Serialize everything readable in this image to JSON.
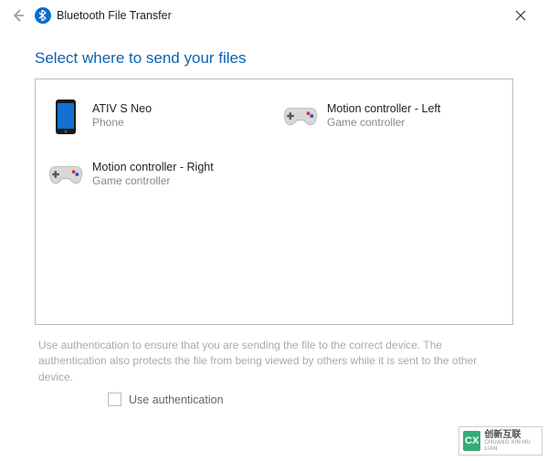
{
  "window": {
    "title": "Bluetooth File Transfer",
    "heading": "Select where to send your files"
  },
  "devices": [
    {
      "name": "ATIV S Neo",
      "type": "Phone",
      "icon": "phone"
    },
    {
      "name": "Motion controller - Left",
      "type": "Game controller",
      "icon": "gamepad"
    },
    {
      "name": "Motion controller - Right",
      "type": "Game controller",
      "icon": "gamepad"
    }
  ],
  "hint": "Use authentication to ensure that you are sending the file to the correct device. The authentication also protects the file from being viewed by others while it is sent to the other device.",
  "auth": {
    "label": "Use authentication",
    "checked": false
  },
  "watermark": {
    "badge": "CX",
    "line1": "创新互联",
    "line2": "CHUANG XIN HU LIAN"
  }
}
